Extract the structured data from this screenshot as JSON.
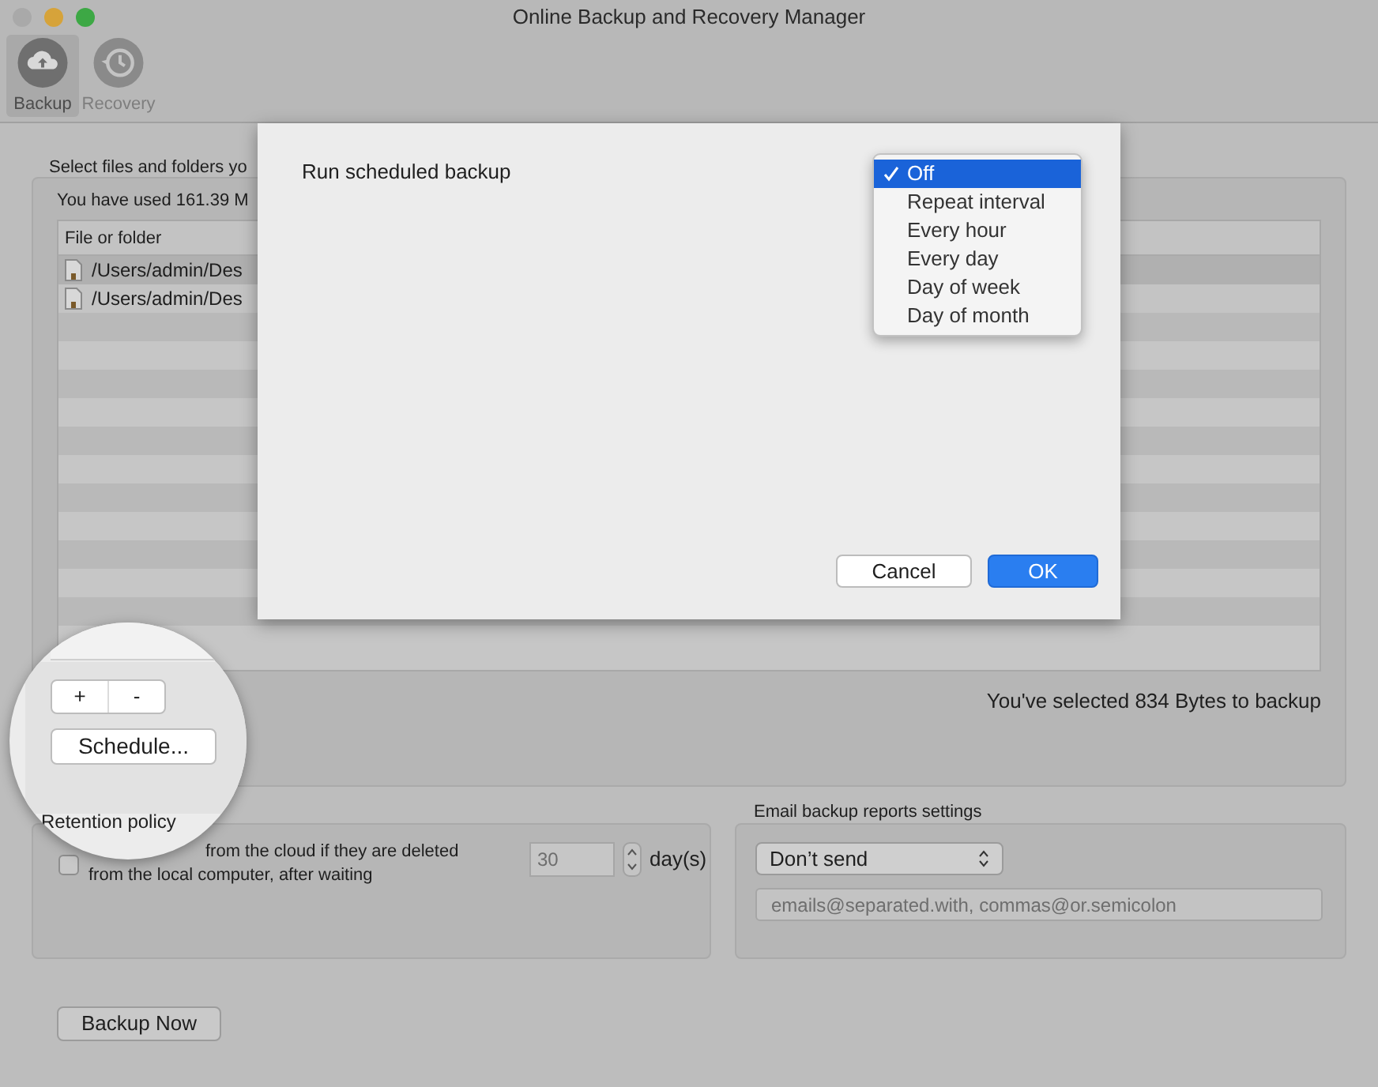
{
  "window": {
    "title": "Online Backup and Recovery Manager"
  },
  "toolbar": [
    {
      "label": "Backup",
      "selected": true,
      "kind": "backup"
    },
    {
      "label": "Recovery",
      "selected": false,
      "kind": "recovery"
    }
  ],
  "files": {
    "instruction": "Select files and folders yo",
    "usage": "You have used 161.39 M",
    "table": {
      "columns": [
        "File or folder"
      ],
      "rows": [
        "/Users/admin/Des",
        "/Users/admin/Des"
      ]
    },
    "selection_summary": "You've selected 834 Bytes to backup"
  },
  "magnifier": {
    "add": "+",
    "remove": "-",
    "schedule": "Schedule...",
    "retention_title": "Retention policy"
  },
  "retention": {
    "checked": false,
    "label_lines": [
      "from the cloud if they are deleted",
      "from the local computer, after waiting"
    ],
    "days": "30",
    "unit": "day(s)"
  },
  "email": {
    "title": "Email backup reports settings",
    "select": "Don’t send",
    "placeholder": "emails@separated.with, commas@or.semicolon"
  },
  "backup_button": "Backup Now",
  "dialog": {
    "label": "Run scheduled backup",
    "menu": [
      {
        "label": "Off",
        "selected": true
      },
      {
        "label": "Repeat interval",
        "selected": false
      },
      {
        "label": "Every hour",
        "selected": false
      },
      {
        "label": "Every day",
        "selected": false
      },
      {
        "label": "Day of week",
        "selected": false
      },
      {
        "label": "Day of month",
        "selected": false
      }
    ],
    "buttons": [
      {
        "label": "Cancel",
        "kind": "default"
      },
      {
        "label": "OK",
        "kind": "primary"
      }
    ]
  }
}
